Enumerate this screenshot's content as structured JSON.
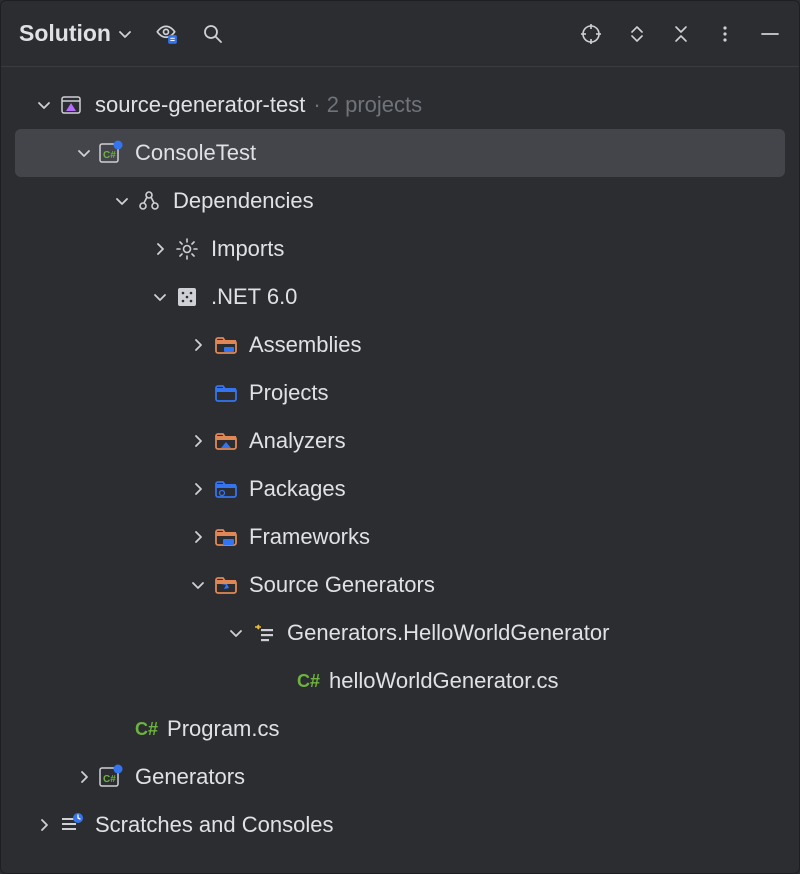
{
  "panel": {
    "title": "Solution"
  },
  "tree": {
    "solution": {
      "name": "source-generator-test",
      "suffix": "· 2 projects"
    },
    "consoleTest": "ConsoleTest",
    "dependencies": "Dependencies",
    "imports": "Imports",
    "net60": ".NET 6.0",
    "assemblies": "Assemblies",
    "projects": "Projects",
    "analyzers": "Analyzers",
    "packages": "Packages",
    "frameworks": "Frameworks",
    "sourceGenerators": "Source Generators",
    "helloGen": "Generators.HelloWorldGenerator",
    "helloGenFile": "helloWorldGenerator.cs",
    "programCs": "Program.cs",
    "generators": "Generators",
    "scratches": "Scratches and Consoles",
    "csLabel": "C#"
  }
}
